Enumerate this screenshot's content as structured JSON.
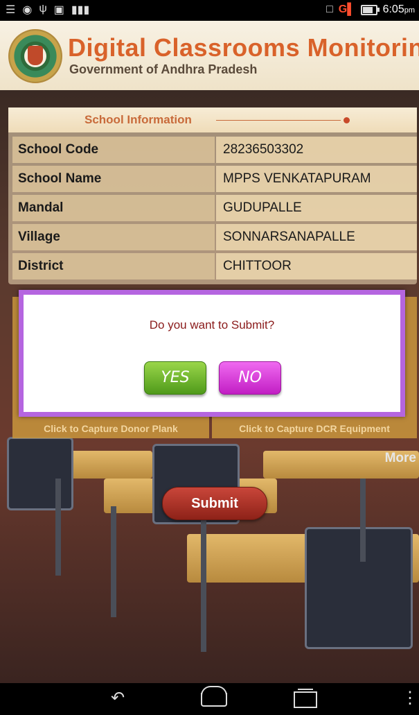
{
  "status_bar": {
    "left_icons": [
      "notification-icon",
      "browser-icon",
      "usb-icon",
      "clipboard-icon",
      "barcode-icon"
    ],
    "right_icons": [
      "vibrate-icon",
      "signal-icon",
      "battery-icon"
    ],
    "network": "G",
    "time": "6:05",
    "ampm": "pm"
  },
  "header": {
    "title": "Digital Classrooms Monitoring",
    "subtitle": "Government of Andhra Pradesh"
  },
  "school_info": {
    "heading": "School Information",
    "rows": [
      {
        "label": "School Code",
        "value": "28236503302"
      },
      {
        "label": "School Name",
        "value": "MPPS VENKATAPURAM"
      },
      {
        "label": "Mandal",
        "value": "GUDUPALLE"
      },
      {
        "label": "Village",
        "value": "SONNARSANAPALLE"
      },
      {
        "label": "District",
        "value": "CHITTOOR"
      }
    ]
  },
  "capture": {
    "left_label": "Click to Capture Donor Plank",
    "right_label": "Click to Capture DCR Equipment"
  },
  "more_label": "More",
  "submit_label": "Submit",
  "dialog": {
    "message": "Do you want to Submit?",
    "yes_label": "YES",
    "no_label": "NO",
    "border_color": "#b565e0"
  },
  "nav": {
    "back_icon": "back-icon",
    "home_icon": "home-icon",
    "recents_icon": "recents-icon",
    "menu_icon": "menu-icon"
  }
}
